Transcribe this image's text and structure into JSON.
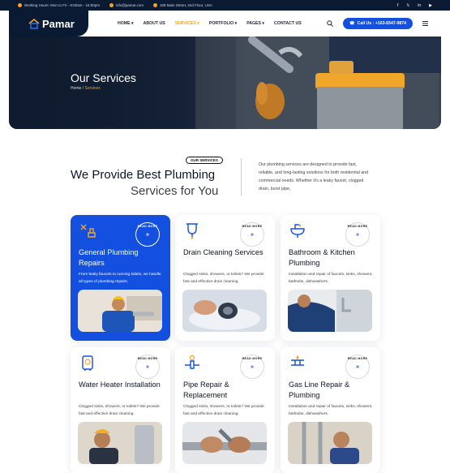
{
  "topbar": {
    "hours": "Working Hours: Mon to Fri - 8:00am - 16:00pm",
    "email": "info@pamar.com",
    "address": "108 Main Street, 2nd Floor, USA",
    "social": [
      "f",
      "𝕏",
      "in",
      "▶"
    ]
  },
  "brand": {
    "name": "Pamar"
  },
  "nav": {
    "items": [
      "HOME ▾",
      "ABOUT US",
      "SERVICES ▾",
      "PORTFOLIO ▾",
      "PAGES ▾",
      "CONTACT US"
    ],
    "call": "Call Us : +163-6547-9874"
  },
  "hero": {
    "title": "Our Services",
    "home": "Home",
    "sep": " / ",
    "current": "Services"
  },
  "intro": {
    "badge": "OUR SERVICES",
    "heading1": "We Provide Best Plumbing",
    "heading2": "Services for You",
    "paragraph": "Our plumbing services are designed to provide fast, reliable, and long-lasting solutions for both residential and commercial needs. Whether it's a leaky faucet, clogged drain, burst pipe,"
  },
  "read_more": "READ MORE",
  "cards": [
    {
      "title": "General Plumbing Repairs",
      "desc": "From leaky faucets to running toilets, we handle all types of plumbing repairs."
    },
    {
      "title": "Drain Cleaning Services",
      "desc": "Clogged sinks, showers, or toilets? We provide fast and effective drain cleaning."
    },
    {
      "title": "Bathroom & Kitchen Plumbing",
      "desc": "Installation and repair of faucets, sinks, showers, bathtubs, dishwashers."
    },
    {
      "title": "Water Heater Installation",
      "desc": "Clogged sinks, showers, or toilets? We provide fast and effective drain cleaning."
    },
    {
      "title": "Pipe Repair & Replacement",
      "desc": "Clogged sinks, showers, or toilets? We provide fast and effective drain cleaning."
    },
    {
      "title": "Gas Line Repair & Plumbing",
      "desc": "Installation and repair of faucets, sinks, showers, bathtubs, dishwashers."
    }
  ],
  "colors": {
    "primary": "#1350e0",
    "accent": "#f5a524",
    "dark": "#0b1a33"
  }
}
